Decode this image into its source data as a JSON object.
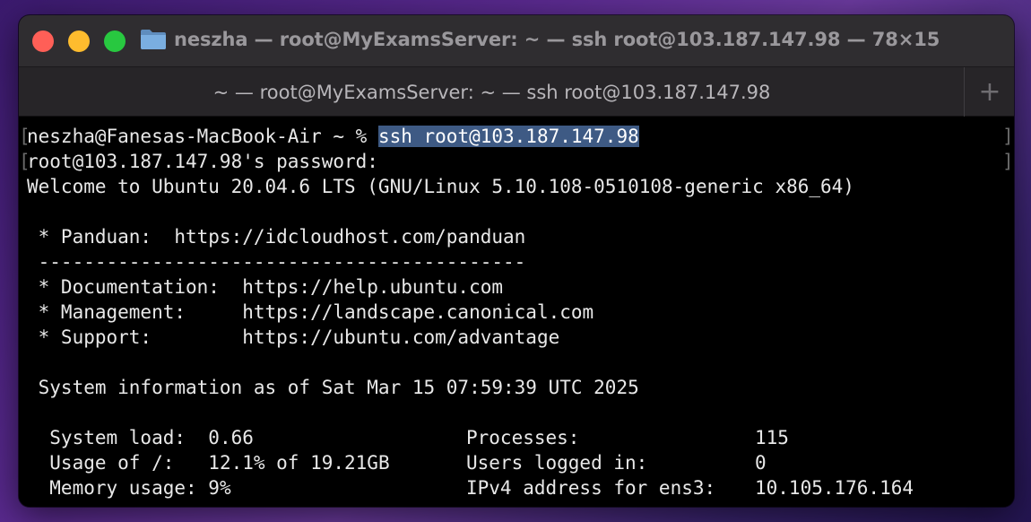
{
  "window": {
    "title": "neszha — root@MyExamsServer: ~ — ssh root@103.187.147.98 — 78×15",
    "traffic_lights": [
      "close",
      "minimize",
      "maximize"
    ],
    "icon": "folder-icon"
  },
  "tabs": [
    {
      "label": "~ — root@MyExamsServer: ~ — ssh root@103.187.147.98",
      "active": true
    }
  ],
  "new_tab_label": "+",
  "terminal": {
    "prompt_line": {
      "prompt": "neszha@Fanesas-MacBook-Air ~ % ",
      "command": "ssh root@103.187.147.98"
    },
    "password_line": "root@103.187.147.98's password:",
    "lines": [
      "Welcome to Ubuntu 20.04.6 LTS (GNU/Linux 5.10.108-0510108-generic x86_64)",
      "",
      " * Panduan:  https://idcloudhost.com/panduan",
      " -------------------------------------------",
      " * Documentation:  https://help.ubuntu.com",
      " * Management:     https://landscape.canonical.com",
      " * Support:        https://ubuntu.com/advantage",
      "",
      " System information as of Sat Mar 15 07:59:39 UTC 2025",
      ""
    ],
    "sysinfo": [
      {
        "label": "  System load:  ",
        "value": "0.66",
        "label2": "Processes:",
        "value2": "115"
      },
      {
        "label": "  Usage of /:   ",
        "value": "12.1% of 19.21GB",
        "label2": "Users logged in:",
        "value2": "0"
      },
      {
        "label": "  Memory usage: ",
        "value": "9%",
        "label2": "IPv4 address for ens3:",
        "value2": "10.105.176.164"
      }
    ],
    "mark_left": "[",
    "mark_right": "]"
  },
  "colors": {
    "titlebar": "#2f2d30",
    "tabbar": "#272528",
    "terminal_bg": "#000000",
    "terminal_fg": "#e8e8e8",
    "selection": "#3e5a84",
    "close": "#ff5f57",
    "minimize": "#febc2e",
    "maximize": "#28c840"
  }
}
